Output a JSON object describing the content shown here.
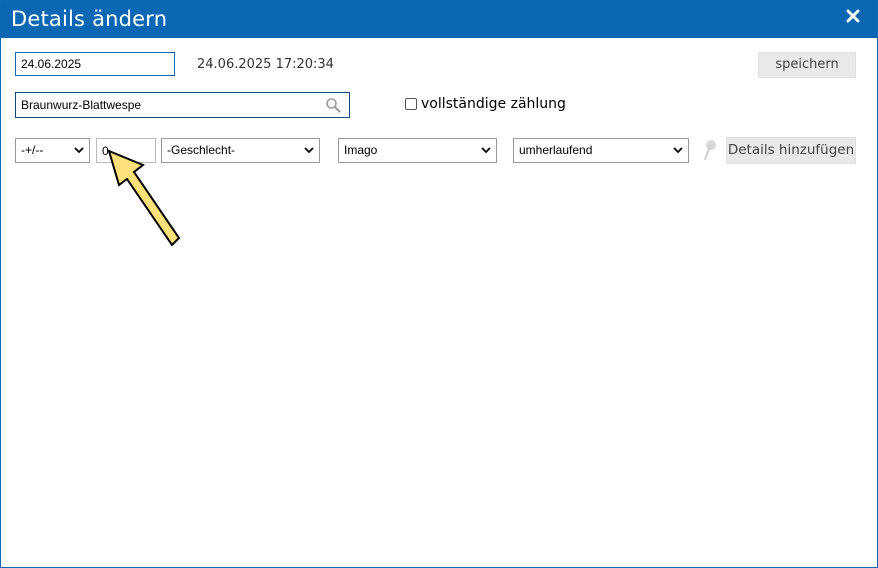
{
  "dialog": {
    "title": "Details ändern"
  },
  "form": {
    "date_value": "24.06.2025",
    "timestamp": "24.06.2025 17:20:34",
    "save_label": "speichern",
    "species_value": "Braunwurz-Blattwespe",
    "complete_count_label": "vollständige zählung",
    "complete_count_checked": false
  },
  "detail_row": {
    "sign_selected": "-+/--",
    "count_value": "0",
    "sex_selected": "-Geschlecht-",
    "stage_selected": "Imago",
    "behavior_selected": "umherlaufend",
    "add_details_label": "Details hinzufügen"
  },
  "icons": {
    "close": "close-icon",
    "search": "search-icon",
    "pin": "pin-icon",
    "arrow": "arrow-annotation-icon"
  },
  "colors": {
    "titlebar": "#0a67b4",
    "arrow_fill": "#fde07a",
    "button_bg": "#e9e9e9"
  }
}
